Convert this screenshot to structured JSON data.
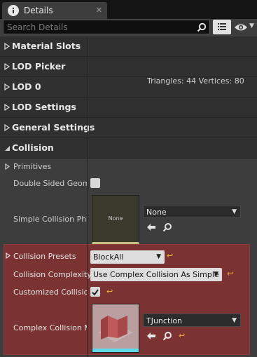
{
  "tab": {
    "title": "Details",
    "close": "✕",
    "icon": "info-icon"
  },
  "toolbar": {
    "search_placeholder": "Search Details",
    "search_icon": "search-icon",
    "view_icon": "list-view-icon",
    "eye_icon": "eye-icon",
    "eye_caret": "▼"
  },
  "categories": [
    {
      "label": "Material Slots",
      "expanded": false
    },
    {
      "label": "LOD Picker",
      "expanded": false
    },
    {
      "label": "LOD 0",
      "expanded": false
    },
    {
      "label": "LOD Settings",
      "expanded": false
    },
    {
      "label": "General Settings",
      "expanded": false
    },
    {
      "label": "Collision",
      "expanded": true
    }
  ],
  "lod0_info": "Triangles: 44   Vertices: 80",
  "collision": {
    "primitives_label": "Primitives",
    "double_sided_label": "Double Sided Geomet",
    "simple_collision_label": "Simple Collision Phys",
    "simple_thumb_text": "None",
    "simple_dropdown": "None",
    "presets_label": "Collision Presets",
    "presets_value": "BlockAll",
    "complexity_label": "Collision Complexity",
    "complexity_value": "Use Complex Collision As Simple",
    "customized_label": "Customized Collision",
    "complex_mesh_label": "Complex Collision Me",
    "complex_mesh_value": "TJunction"
  },
  "colors": {
    "highlight": "#7a3232",
    "reset_arrow": "#f0b030"
  }
}
